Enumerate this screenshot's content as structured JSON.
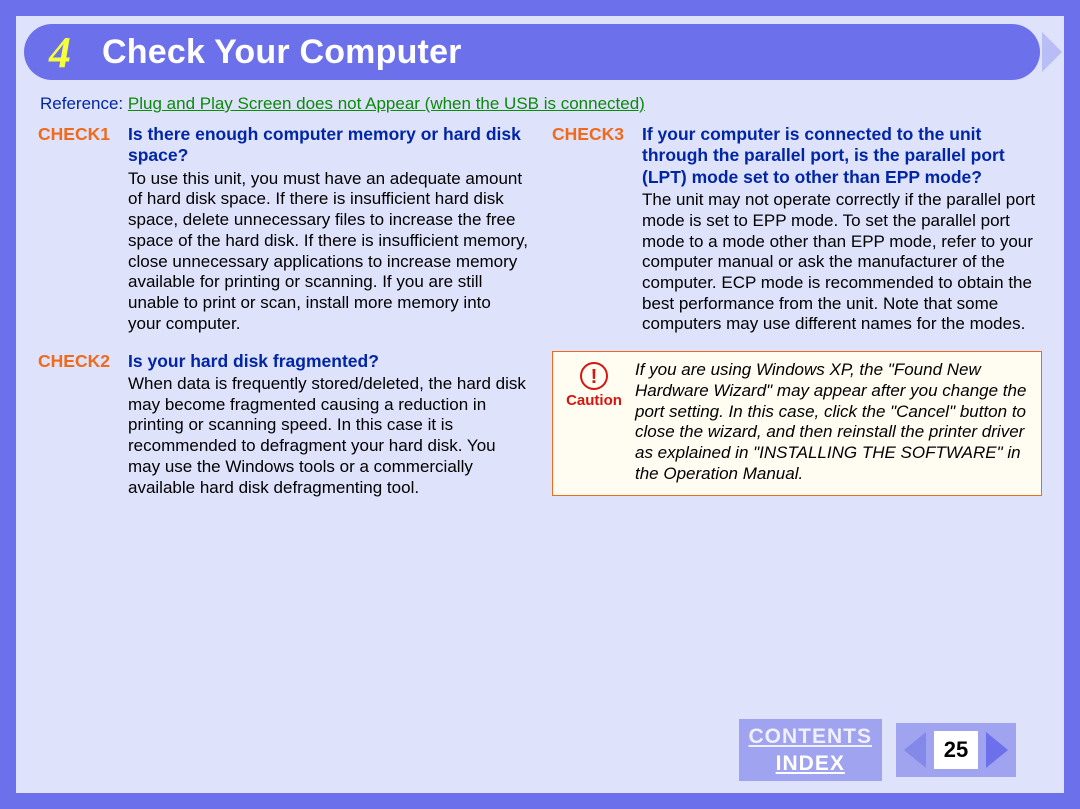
{
  "chapter": {
    "number": "4",
    "title": "Check Your Computer"
  },
  "reference": {
    "label": "Reference:",
    "link_text": "Plug and Play Screen does not Appear (when the USB is connected)"
  },
  "checks": [
    {
      "label": "CHECK1",
      "question": "Is there enough computer memory or hard disk space?",
      "body": "To use this unit, you must have an adequate amount of hard disk space. If there is insufficient hard disk space, delete unnecessary files to increase the free space of the hard disk. If there is insufficient memory, close unnecessary applications to increase memory available for printing or scanning. If you are still unable to print or scan, install more memory into your computer."
    },
    {
      "label": "CHECK2",
      "question": "Is your hard disk fragmented?",
      "body": "When data is frequently stored/deleted, the hard disk may become fragmented causing a reduction in printing or scanning speed. In this case it is recommended to defragment your hard disk. You may use the Windows tools or a commercially available hard disk defragmenting tool."
    },
    {
      "label": "CHECK3",
      "question": "If your computer is connected to the unit through the parallel port, is the parallel port (LPT) mode set to other than EPP mode?",
      "body": "The unit may not operate correctly if the parallel port mode is set to EPP mode. To set the parallel port mode to a mode other than EPP mode, refer to your computer manual or ask the manufacturer of the computer. ECP mode is recommended to obtain the best performance from the unit. Note that some computers may use different names for the modes."
    }
  ],
  "caution": {
    "icon_glyph": "!",
    "word": "Caution",
    "body": "If you are using Windows XP, the \"Found New Hardware Wizard\" may appear after you change the port setting. In this case, click the \"Cancel\" button to close the wizard, and then reinstall the printer driver as explained in \"INSTALLING THE SOFTWARE\" in the Operation Manual."
  },
  "footer": {
    "contents_label": "CONTENTS",
    "index_label": "INDEX",
    "page_number": "25"
  }
}
